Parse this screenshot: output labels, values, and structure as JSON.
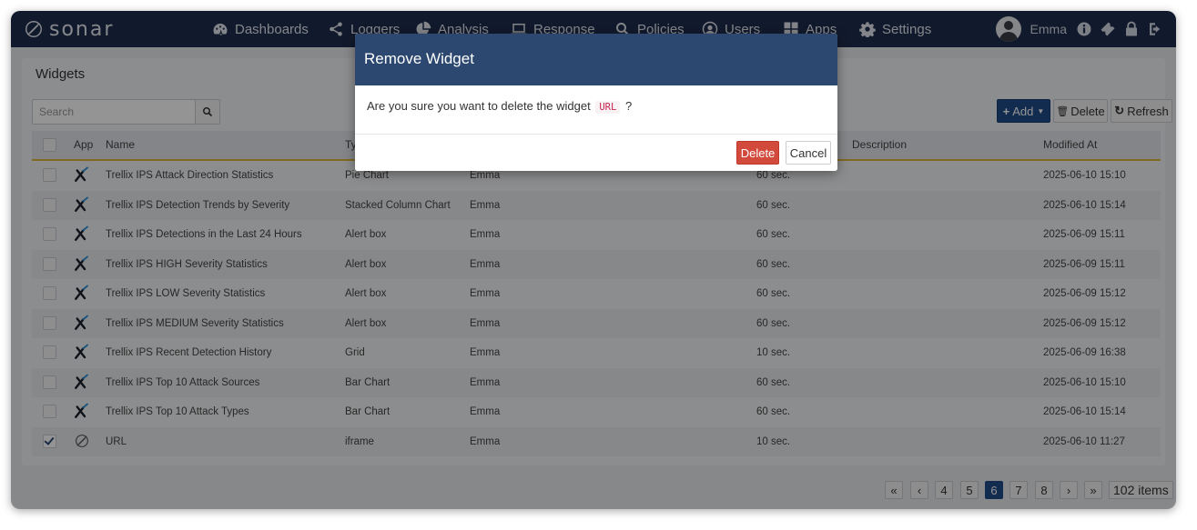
{
  "brand": {
    "name": "sonar"
  },
  "nav": [
    {
      "label": "Dashboards",
      "icon": "dashboard-icon"
    },
    {
      "label": "Loggers",
      "icon": "share-icon"
    },
    {
      "label": "Analysis",
      "icon": "pie-chart-icon"
    },
    {
      "label": "Response",
      "icon": "laptop-icon"
    },
    {
      "label": "Policies",
      "icon": "search-icon"
    },
    {
      "label": "Users",
      "icon": "user-circle-icon"
    },
    {
      "label": "Apps",
      "icon": "grid-icon"
    },
    {
      "label": "Settings",
      "icon": "gear-icon"
    }
  ],
  "user": {
    "name": "Emma"
  },
  "panel": {
    "title": "Widgets"
  },
  "search": {
    "placeholder": "Search"
  },
  "toolbar": {
    "add_label": "Add",
    "delete_label": "Delete",
    "refresh_label": "Refresh"
  },
  "table": {
    "headers": {
      "app": "App",
      "name": "Name",
      "type": "Ty",
      "description": "Description",
      "modified": "Modified At"
    },
    "rows": [
      {
        "name": "Trellix IPS Attack Direction Statistics",
        "type": "Pie Chart",
        "owner": "Emma",
        "refresh": "60 sec.",
        "modified": "2025-06-10 15:10",
        "checked": false,
        "app": "trellix-icon"
      },
      {
        "name": "Trellix IPS Detection Trends by Severity",
        "type": "Stacked Column Chart",
        "owner": "Emma",
        "refresh": "60 sec.",
        "modified": "2025-06-10 15:14",
        "checked": false,
        "app": "trellix-icon"
      },
      {
        "name": "Trellix IPS Detections in the Last 24 Hours",
        "type": "Alert box",
        "owner": "Emma",
        "refresh": "60 sec.",
        "modified": "2025-06-09 15:11",
        "checked": false,
        "app": "trellix-icon"
      },
      {
        "name": "Trellix IPS HIGH Severity Statistics",
        "type": "Alert box",
        "owner": "Emma",
        "refresh": "60 sec.",
        "modified": "2025-06-09 15:11",
        "checked": false,
        "app": "trellix-icon"
      },
      {
        "name": "Trellix IPS LOW Severity Statistics",
        "type": "Alert box",
        "owner": "Emma",
        "refresh": "60 sec.",
        "modified": "2025-06-09 15:12",
        "checked": false,
        "app": "trellix-icon"
      },
      {
        "name": "Trellix IPS MEDIUM Severity Statistics",
        "type": "Alert box",
        "owner": "Emma",
        "refresh": "60 sec.",
        "modified": "2025-06-09 15:12",
        "checked": false,
        "app": "trellix-icon"
      },
      {
        "name": "Trellix IPS Recent Detection History",
        "type": "Grid",
        "owner": "Emma",
        "refresh": "10 sec.",
        "modified": "2025-06-09 16:38",
        "checked": false,
        "app": "trellix-icon"
      },
      {
        "name": "Trellix IPS Top 10 Attack Sources",
        "type": "Bar Chart",
        "owner": "Emma",
        "refresh": "60 sec.",
        "modified": "2025-06-10 15:10",
        "checked": false,
        "app": "trellix-icon"
      },
      {
        "name": "Trellix IPS Top 10 Attack Types",
        "type": "Bar Chart",
        "owner": "Emma",
        "refresh": "60 sec.",
        "modified": "2025-06-10 15:14",
        "checked": false,
        "app": "trellix-icon"
      },
      {
        "name": "URL",
        "type": "iframe",
        "owner": "Emma",
        "refresh": "10 sec.",
        "modified": "2025-06-10 11:27",
        "checked": true,
        "app": "sonar-icon"
      }
    ]
  },
  "pagination": {
    "first": "«",
    "prev": "‹",
    "next": "›",
    "last": "»",
    "pages": [
      "4",
      "5",
      "6",
      "7",
      "8"
    ],
    "current": "6",
    "total": "102 items"
  },
  "modal": {
    "title": "Remove Widget",
    "message_prefix": "Are you sure you want to delete the widget",
    "widget_name": "URL",
    "message_suffix": "?",
    "delete_label": "Delete",
    "cancel_label": "Cancel"
  },
  "colors": {
    "nav_bg": "#1e2d4d",
    "modal_header": "#2c4870",
    "danger": "#d24a3c",
    "accent_border": "#e0b338",
    "primary": "#1f4c8a"
  }
}
